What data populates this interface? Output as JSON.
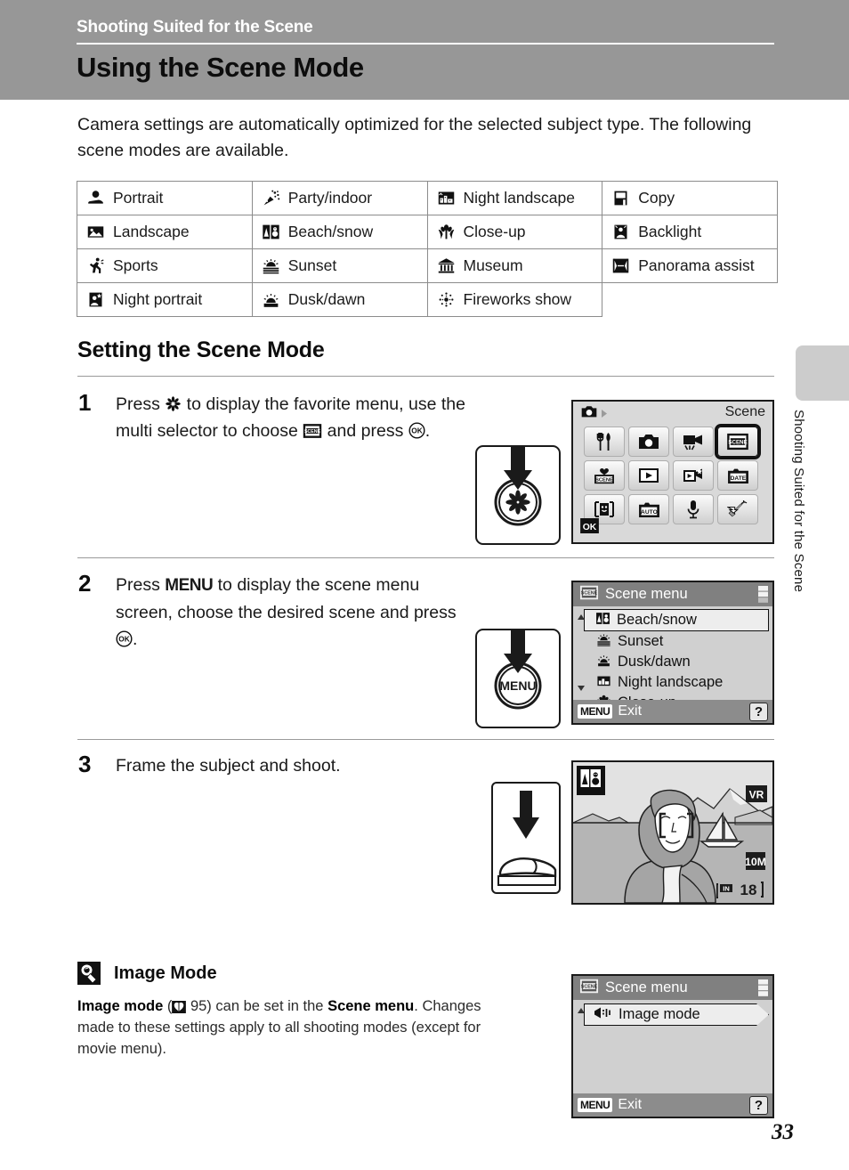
{
  "header": {
    "kicker": "Shooting Suited for the Scene",
    "title": "Using the Scene Mode"
  },
  "intro": "Camera settings are automatically optimized for the selected subject type. The following scene modes are available.",
  "scene_table": {
    "rows": [
      [
        {
          "icon": "portrait-icon",
          "label": "Portrait"
        },
        {
          "icon": "party-indoor-icon",
          "label": "Party/indoor"
        },
        {
          "icon": "night-landscape-icon",
          "label": "Night landscape"
        },
        {
          "icon": "copy-icon",
          "label": "Copy"
        }
      ],
      [
        {
          "icon": "landscape-icon",
          "label": "Landscape"
        },
        {
          "icon": "beach-snow-icon",
          "label": "Beach/snow"
        },
        {
          "icon": "close-up-icon",
          "label": "Close-up"
        },
        {
          "icon": "backlight-icon",
          "label": "Backlight"
        }
      ],
      [
        {
          "icon": "sports-icon",
          "label": "Sports"
        },
        {
          "icon": "sunset-icon",
          "label": "Sunset"
        },
        {
          "icon": "museum-icon",
          "label": "Museum"
        },
        {
          "icon": "panorama-assist-icon",
          "label": "Panorama assist"
        }
      ],
      [
        {
          "icon": "night-portrait-icon",
          "label": "Night portrait"
        },
        {
          "icon": "dusk-dawn-icon",
          "label": "Dusk/dawn"
        },
        {
          "icon": "fireworks-show-icon",
          "label": "Fireworks show"
        },
        {
          "icon": "",
          "label": ""
        }
      ]
    ]
  },
  "section": {
    "title": "Setting the Scene Mode"
  },
  "steps": [
    {
      "number": "1",
      "text_parts": {
        "a": "Press ",
        "b": " to display the favorite menu, use the multi selector to choose ",
        "c": " and press ",
        "d": "."
      },
      "key_glyph": "asterisk-button-icon"
    },
    {
      "number": "2",
      "text_parts": {
        "a": "Press ",
        "b": " to display the scene menu screen, choose the desired scene and press ",
        "c": ".",
        "menu_word": "MENU"
      },
      "key_glyph": "menu-button-icon"
    },
    {
      "number": "3",
      "text": "Frame the subject and shoot.",
      "key_glyph": "shutter-press-icon"
    }
  ],
  "screen_favorite": {
    "title": "Scene",
    "mode_indicator": "camera-mode-icon",
    "ok_label": "OK",
    "cells": [
      {
        "icon": "restaurant-icon",
        "selected": false
      },
      {
        "icon": "camera-icon",
        "selected": false
      },
      {
        "icon": "movie-icon",
        "selected": false
      },
      {
        "icon": "scene-icon",
        "selected": true
      },
      {
        "icon": "favorite-scene-icon",
        "selected": false
      },
      {
        "icon": "playback-icon",
        "selected": false
      },
      {
        "icon": "slideshow-icon",
        "selected": false
      },
      {
        "icon": "date-icon",
        "selected": false
      },
      {
        "icon": "smile-face-icon",
        "selected": false
      },
      {
        "icon": "auto-icon",
        "selected": false
      },
      {
        "icon": "voice-recording-icon",
        "selected": false
      },
      {
        "icon": "setup-wrench-icon",
        "selected": false
      }
    ]
  },
  "screen_scene_menu": {
    "title": "Scene menu",
    "title_icon": "scene-icon",
    "items": [
      {
        "icon": "beach-snow-icon",
        "label": "Beach/snow",
        "selected": true
      },
      {
        "icon": "sunset-icon",
        "label": "Sunset",
        "selected": false
      },
      {
        "icon": "dusk-dawn-icon",
        "label": "Dusk/dawn",
        "selected": false
      },
      {
        "icon": "night-landscape-icon",
        "label": "Night landscape",
        "selected": false
      },
      {
        "icon": "close-up-icon",
        "label": "Close-up",
        "selected": false
      }
    ],
    "footer": {
      "menu_chip": "MENU",
      "exit_label": "Exit",
      "help_label": "?"
    }
  },
  "screen_live_view": {
    "mode_badge": "beach-snow-icon",
    "vr_label": "VR",
    "image_mode_badge": "10M",
    "memory_label": "IN",
    "shots_remaining": "18"
  },
  "note": {
    "icon": "note-bulb-icon",
    "title": "Image Mode",
    "body_parts": {
      "a": "Image mode",
      "b": " (",
      "ref_icon": "book-ref-icon",
      "c": " 95) can be set in the ",
      "d": "Scene menu",
      "e": ". Changes made to these settings apply to all shooting modes (except for movie menu)."
    }
  },
  "screen_image_mode_menu": {
    "title": "Scene menu",
    "item_label": "Image mode",
    "item_icon": "image-mode-icon",
    "footer": {
      "menu_chip": "MENU",
      "exit_label": "Exit",
      "help_label": "?"
    }
  },
  "sidebar": {
    "vertical_text": "Shooting Suited for the Scene"
  },
  "page_number": "33"
}
